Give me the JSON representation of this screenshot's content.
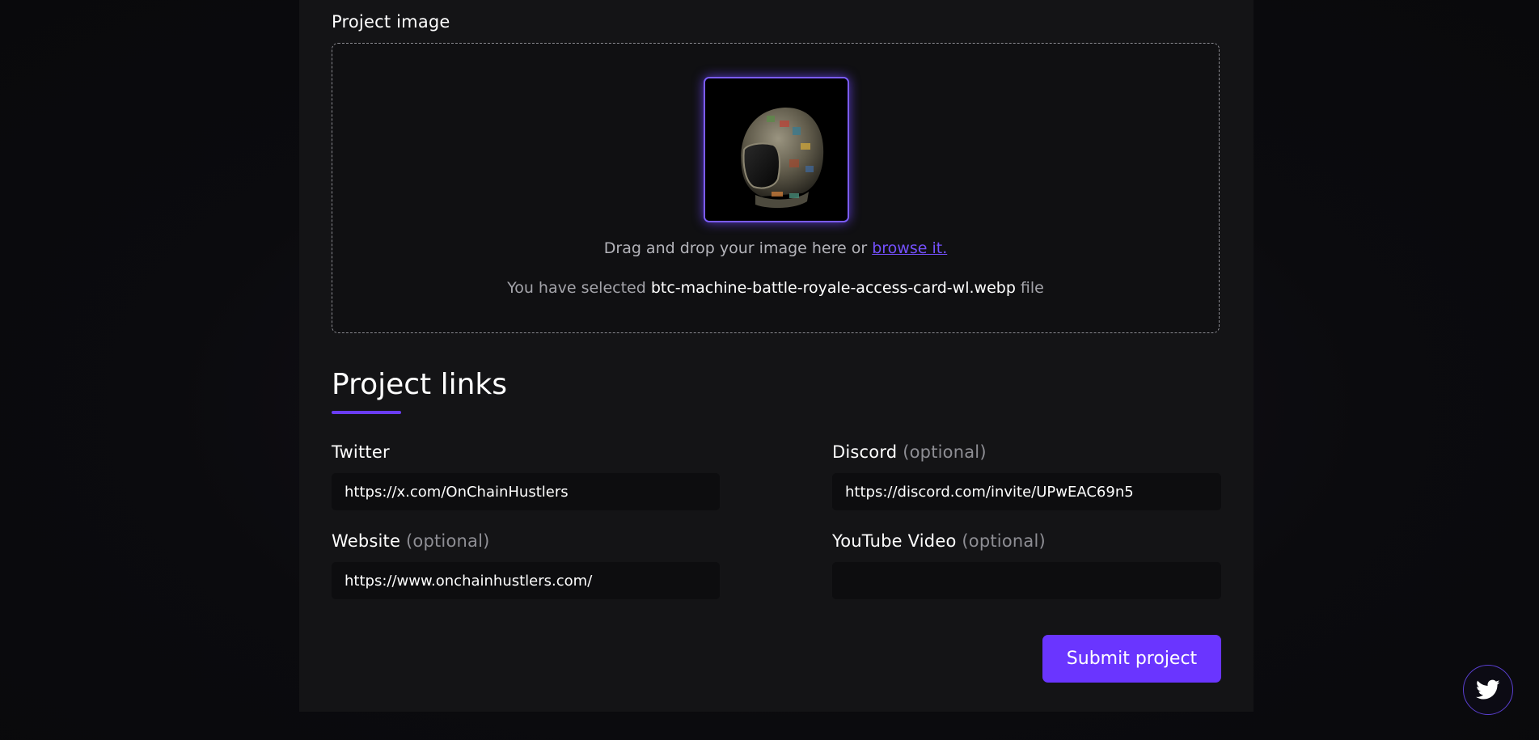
{
  "image_section": {
    "label": "Project image",
    "drag_text": "Drag and drop your image here or ",
    "browse_link": "browse it.",
    "selected_prefix": "You have selected ",
    "selected_filename": "btc-machine-battle-royale-access-card-wl.webp",
    "selected_suffix": " file",
    "preview_icon": "helmet-image"
  },
  "links_section": {
    "title": "Project links",
    "twitter": {
      "label": "Twitter",
      "value": "https://x.com/OnChainHustlers"
    },
    "discord": {
      "label": "Discord",
      "optional": "(optional)",
      "value": "https://discord.com/invite/UPwEAC69n5"
    },
    "website": {
      "label": "Website",
      "optional": "(optional)",
      "value": "https://www.onchainhustlers.com/"
    },
    "youtube": {
      "label": "YouTube Video",
      "optional": "(optional)",
      "value": ""
    }
  },
  "submit_label": "Submit project",
  "floating_button_icon": "twitter-icon",
  "colors": {
    "accent": "#6a35ff",
    "panel": "#141416",
    "background": "#0a0a0d"
  }
}
